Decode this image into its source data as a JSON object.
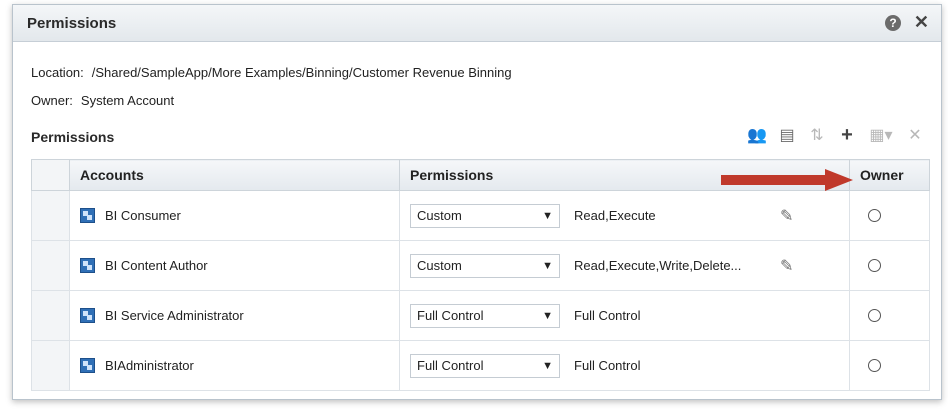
{
  "dialog": {
    "title": "Permissions",
    "help_icon": "question-circle-icon",
    "close_icon": "close-x-icon",
    "help_glyph": "?",
    "close_glyph": "✕"
  },
  "location": {
    "label": "Location:",
    "value": "/Shared/SampleApp/More Examples/Binning/Customer Revenue Binning"
  },
  "owner": {
    "label": "Owner:",
    "value": "System Account"
  },
  "section": {
    "title": "Permissions"
  },
  "toolbar": {
    "buttons": [
      {
        "icon": "add-users-icon",
        "glyph": "👥",
        "enabled": true
      },
      {
        "icon": "user-list-icon",
        "glyph": "▤",
        "enabled": true
      },
      {
        "icon": "apply-recursive-icon",
        "glyph": "⇅",
        "enabled": false
      },
      {
        "icon": "add-icon",
        "glyph": "+",
        "enabled": true
      },
      {
        "icon": "set-permissions-dropdown-icon",
        "glyph": "▦▾",
        "enabled": false
      },
      {
        "icon": "delete-icon",
        "glyph": "✕",
        "enabled": false
      }
    ]
  },
  "table": {
    "headers": {
      "accounts": "Accounts",
      "permissions": "Permissions",
      "owner": "Owner"
    },
    "rows": [
      {
        "account": "BI Consumer",
        "permission": "Custom",
        "detail": "Read,Execute",
        "editable": true,
        "owner": false
      },
      {
        "account": "BI Content Author",
        "permission": "Custom",
        "detail": "Read,Execute,Write,Delete...",
        "editable": true,
        "owner": false
      },
      {
        "account": "BI Service Administrator",
        "permission": "Full Control",
        "detail": "Full Control",
        "editable": false,
        "owner": false
      },
      {
        "account": "BIAdministrator",
        "permission": "Full Control",
        "detail": "Full Control",
        "editable": false,
        "owner": false
      }
    ]
  },
  "colors": {
    "annotation_arrow": "#c0392b",
    "account_icon": "#2f6fb6"
  }
}
